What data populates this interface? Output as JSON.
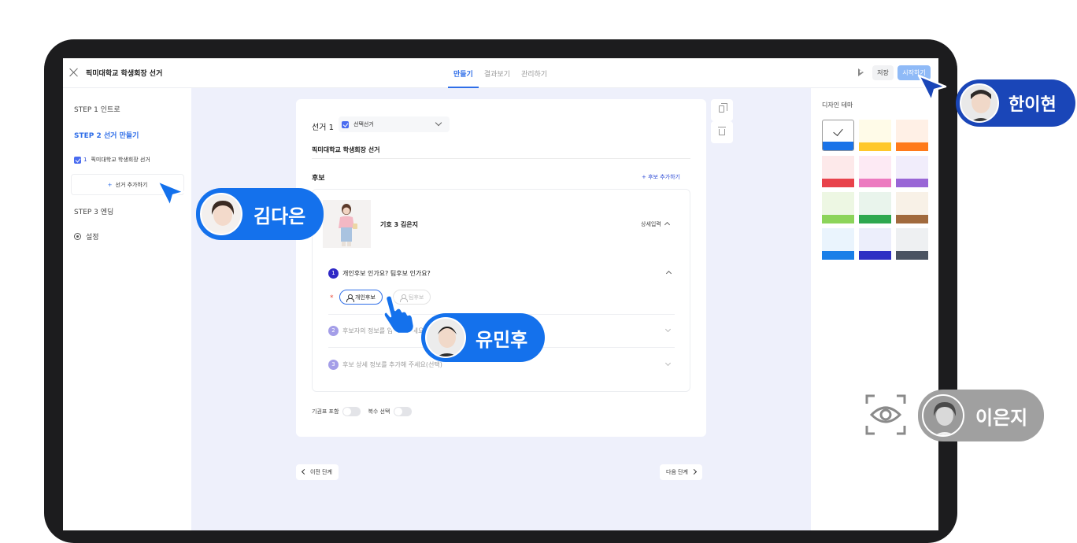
{
  "header": {
    "title": "픽미대학교 학생회장 선거",
    "tabs": [
      {
        "label": "만들기",
        "active": true
      },
      {
        "label": "결과보기",
        "active": false
      },
      {
        "label": "관리하기",
        "active": false
      }
    ],
    "save_label": "저장",
    "start_label": "시작하기"
  },
  "sidebar": {
    "step1": "STEP 1  인트로",
    "step2": "STEP 2  선거 만들기",
    "election_item_num": "1",
    "election_item_label": "픽미대학교 학생회장 선거",
    "add_election_label": "선거 추가하기",
    "step3": "STEP 3  엔딩",
    "settings": "설정"
  },
  "editor": {
    "election_label": "선거 1",
    "election_type": "선택선거",
    "election_name": "픽미대학교 학생회장 선거",
    "candidates_label": "후보",
    "add_candidate_label": "+ 후보 추가하기",
    "candidate_name": "기호 3 김은지",
    "detail_toggle": "상세입력",
    "questions": [
      {
        "num": "1",
        "text": "개인후보 인가요? 팀후보 인가요?",
        "active": true
      },
      {
        "num": "2",
        "text": "후보자의 정보를 입력해 주세요",
        "active": false
      },
      {
        "num": "3",
        "text": "후보 상세 정보를 추가해 주세요(선택)",
        "active": false
      }
    ],
    "required_mark": "*",
    "option_individual": "개인후보",
    "option_team": "팀후보",
    "toggle_abstain": "기권표 포함",
    "toggle_multi": "복수 선택",
    "prev_label": "이전 단계",
    "next_label": "다음 단계"
  },
  "design": {
    "label": "디자인 테마",
    "themes": [
      {
        "bg": "#ffffff",
        "bar": "#1a73e8",
        "selected": true
      },
      {
        "bg": "#fffbe8",
        "bar": "#ffc82c"
      },
      {
        "bg": "#fff0e6",
        "bar": "#ff7a1a"
      },
      {
        "bg": "#fde9ea",
        "bar": "#e8424b"
      },
      {
        "bg": "#fdeaf4",
        "bar": "#ec7ac0"
      },
      {
        "bg": "#f1edfb",
        "bar": "#9966d6"
      },
      {
        "bg": "#edf7e3",
        "bar": "#8cd45a"
      },
      {
        "bg": "#e9f4ec",
        "bar": "#2fa84f"
      },
      {
        "bg": "#f8f1e7",
        "bar": "#a16a3d"
      },
      {
        "bg": "#eaf4fd",
        "bar": "#1a7fe8"
      },
      {
        "bg": "#eceefb",
        "bar": "#2e30c4"
      },
      {
        "bg": "#eef0f2",
        "bar": "#4a5361"
      }
    ]
  },
  "collaborators": [
    {
      "name": "한이현",
      "color": "#1a46b8"
    },
    {
      "name": "김다은",
      "color": "#1471ec"
    },
    {
      "name": "유민후",
      "color": "#1471ec"
    },
    {
      "name": "이은지",
      "color": "#a0a0a0"
    }
  ],
  "colors": {
    "accent": "#2f6ee8",
    "canvas_bg": "#eef0fb"
  }
}
